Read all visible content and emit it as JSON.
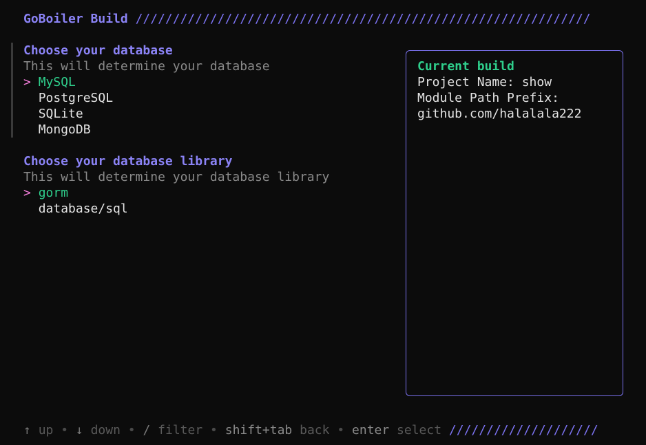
{
  "header": {
    "title": "GoBoiler Build",
    "slashes": "/////////////////////////////////////////////////////////////"
  },
  "database_field": {
    "title": "Choose your database",
    "description": "This will determine your database",
    "cursor": ">",
    "options": [
      "MySQL",
      "PostgreSQL",
      "SQLite",
      "MongoDB"
    ],
    "selected": "MySQL"
  },
  "library_field": {
    "title": "Choose your database library",
    "description": "This will determine your database library",
    "cursor": ">",
    "options": [
      "gorm",
      "database/sql"
    ],
    "selected": "gorm"
  },
  "build_panel": {
    "title": "Current build",
    "project_name_line": "Project Name: show",
    "module_prefix_label": "Module Path Prefix:",
    "module_prefix_value": "github.com/halalala222"
  },
  "help_bar": {
    "items": [
      {
        "key": "↑",
        "desc": "up"
      },
      {
        "key": "↓",
        "desc": "down"
      },
      {
        "key": "/",
        "desc": "filter"
      },
      {
        "key": "shift+tab",
        "desc": "back"
      },
      {
        "key": "enter",
        "desc": "select"
      }
    ],
    "separator": "•",
    "slashes": "////////////////////"
  },
  "colors": {
    "accent": "#7b72f0",
    "selected": "#2fcf8c",
    "cursor": "#f07bd8",
    "background": "#0c0c0c"
  }
}
